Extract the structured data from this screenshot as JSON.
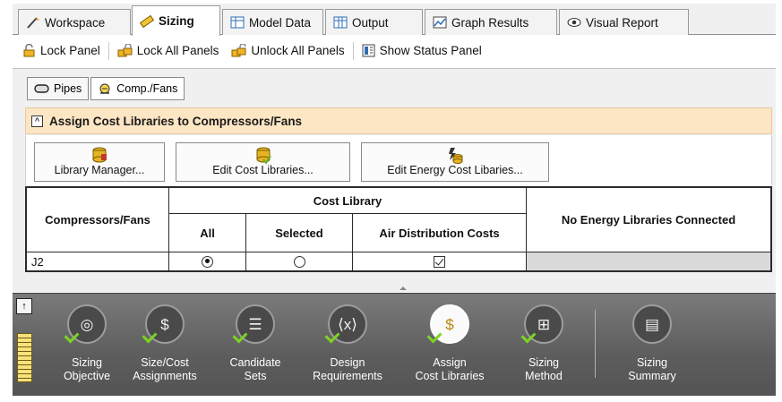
{
  "tabs": [
    {
      "label": "Workspace",
      "icon": "workspace-icon",
      "active": false
    },
    {
      "label": "Sizing",
      "icon": "sizing-icon",
      "active": true
    },
    {
      "label": "Model Data",
      "icon": "model-data-icon",
      "active": false
    },
    {
      "label": "Output",
      "icon": "output-icon",
      "active": false
    },
    {
      "label": "Graph Results",
      "icon": "graph-results-icon",
      "active": false
    },
    {
      "label": "Visual Report",
      "icon": "visual-report-icon",
      "active": false
    }
  ],
  "toolbar": {
    "lock_panel": "Lock Panel",
    "lock_all_panels": "Lock All Panels",
    "unlock_all_panels": "Unlock All Panels",
    "show_status_panel": "Show Status Panel"
  },
  "subtabs": [
    {
      "label": "Pipes",
      "active": false
    },
    {
      "label": "Comp./Fans",
      "active": true
    }
  ],
  "section": {
    "title": "Assign Cost Libraries to Compressors/Fans",
    "collapse_glyph": "^"
  },
  "buttons": {
    "library_manager": "Library Manager...",
    "edit_cost_libraries": "Edit Cost Libraries...",
    "edit_energy_cost_libaries": "Edit Energy Cost Libaries..."
  },
  "table": {
    "col_compressors": "Compressors/Fans",
    "group_cost_library": "Cost Library",
    "col_all": "All",
    "col_selected": "Selected",
    "col_air_distribution": "Air Distribution Costs",
    "col_energy": "No Energy Libraries Connected",
    "rows": [
      {
        "name": "J2",
        "all": true,
        "selected": false,
        "air_distribution": true
      }
    ]
  },
  "dock": {
    "pin_glyph": "↑",
    "items": [
      {
        "line1": "Sizing",
        "line2": "Objective",
        "icon": "target-icon",
        "glyph": "◎",
        "selected": false
      },
      {
        "line1": "Size/Cost",
        "line2": "Assignments",
        "icon": "size-cost-icon",
        "glyph": "$",
        "selected": false
      },
      {
        "line1": "Candidate",
        "line2": "Sets",
        "icon": "candidate-sets-icon",
        "glyph": "☰",
        "selected": false
      },
      {
        "line1": "Design",
        "line2": "Requirements",
        "icon": "design-requirements-icon",
        "glyph": "⟨x⟩",
        "selected": false
      },
      {
        "line1": "Assign",
        "line2": "Cost Libraries",
        "icon": "cost-library-icon",
        "glyph": "$",
        "selected": true
      },
      {
        "line1": "Sizing",
        "line2": "Method",
        "icon": "sizing-method-icon",
        "glyph": "⊞",
        "selected": false
      },
      {
        "line1": "Sizing",
        "line2": "Summary",
        "icon": "clipboard-icon",
        "glyph": "▤",
        "selected": false
      }
    ]
  },
  "colors": {
    "section_header_bg": "#fde6c4",
    "dock_bg": "#5d5d5d",
    "checkmark_green": "#7ed321"
  }
}
